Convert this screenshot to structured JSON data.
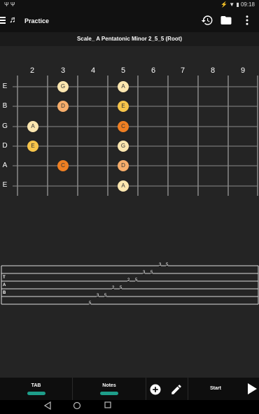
{
  "status": {
    "left": "Ψ  Ψ",
    "right": "⚡ ▼ ▮ 09:18"
  },
  "app": {
    "logo": "♬",
    "title": "Practice"
  },
  "scale": {
    "title": "Scale_ A Pentatonic Minor 2_5_5 (Root)"
  },
  "frets": [
    "2",
    "3",
    "4",
    "5",
    "6",
    "7",
    "8",
    "9"
  ],
  "strings": [
    "E",
    "B",
    "G",
    "D",
    "A",
    "E"
  ],
  "notes": [
    {
      "label": "G",
      "color": "#fde7b0"
    },
    {
      "label": "A",
      "color": "#fde7b0"
    },
    {
      "label": "D",
      "color": "#f6ad6b"
    },
    {
      "label": "E",
      "color": "#f6c44a"
    },
    {
      "label": "A",
      "color": "#fde7b0"
    },
    {
      "label": "C",
      "color": "#ef7f22"
    },
    {
      "label": "E",
      "color": "#f6c44a"
    },
    {
      "label": "G",
      "color": "#fde7b0"
    },
    {
      "label": "C",
      "color": "#ef7f22"
    },
    {
      "label": "D",
      "color": "#f6ad6b"
    },
    {
      "label": "A",
      "color": "#fde7b0"
    }
  ],
  "tab": {
    "labels": [
      "T",
      "A",
      "B"
    ],
    "numbers": [
      "3",
      "5",
      "3",
      "5",
      "2",
      "5",
      "2",
      "5",
      "3",
      "5",
      "5"
    ]
  },
  "bottom": {
    "tab_label": "TAB",
    "notes_label": "Notes",
    "start_label": "Start"
  },
  "icons": {
    "menu": "menu-icon",
    "history": "history-icon",
    "folder": "folder-icon",
    "more": "more-vert-icon"
  },
  "colors": {
    "accent": "#1e9e8a"
  }
}
